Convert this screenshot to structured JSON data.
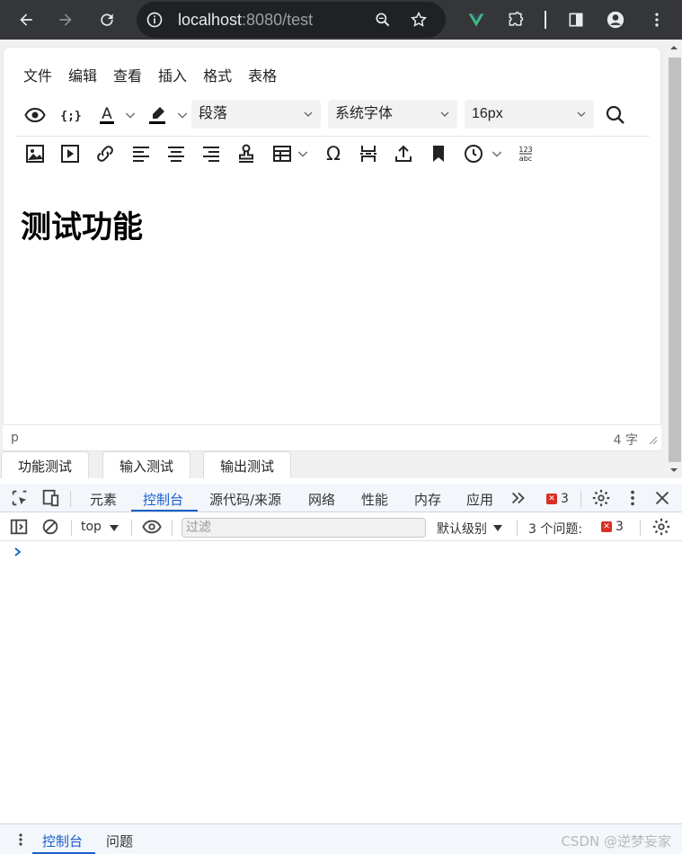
{
  "browser": {
    "url_host": "localhost",
    "url_rest": ":8080/test",
    "colors": {
      "frame": "#35363a",
      "omnibox": "#202124"
    }
  },
  "editor": {
    "menu": [
      "文件",
      "编辑",
      "查看",
      "插入",
      "格式",
      "表格"
    ],
    "block_format": "段落",
    "font_family": "系统字体",
    "font_size": "16px",
    "content_heading": "测试功能",
    "status_path": "p",
    "word_count": "4 字",
    "row1_icons": [
      "preview-eye-icon",
      "code-braces-icon",
      "text-color-icon",
      "highlight-color-icon",
      "search-icon"
    ],
    "row2_icons": [
      "image-icon",
      "video-icon",
      "link-icon",
      "align-left-icon",
      "align-center-icon",
      "align-right-icon",
      "stamp-icon",
      "table-icon",
      "omega-icon",
      "page-break-icon",
      "upload-icon",
      "bookmark-icon",
      "clock-icon",
      "numbers-abc-icon"
    ]
  },
  "page_tabs": [
    "功能测试",
    "输入测试",
    "输出测试"
  ],
  "devtools": {
    "tabs": [
      "元素",
      "控制台",
      "源代码/来源",
      "网络",
      "性能",
      "内存",
      "应用"
    ],
    "active_tab": "控制台",
    "error_count": "3",
    "context": "top",
    "filter_placeholder": "过滤",
    "level": "默认级别",
    "issues_label": "3 个问题:",
    "issues_count": "3",
    "drawer_tabs": [
      "控制台",
      "问题"
    ],
    "accent": "#1a5fc8"
  },
  "watermark": "CSDN @逆梦妄家"
}
